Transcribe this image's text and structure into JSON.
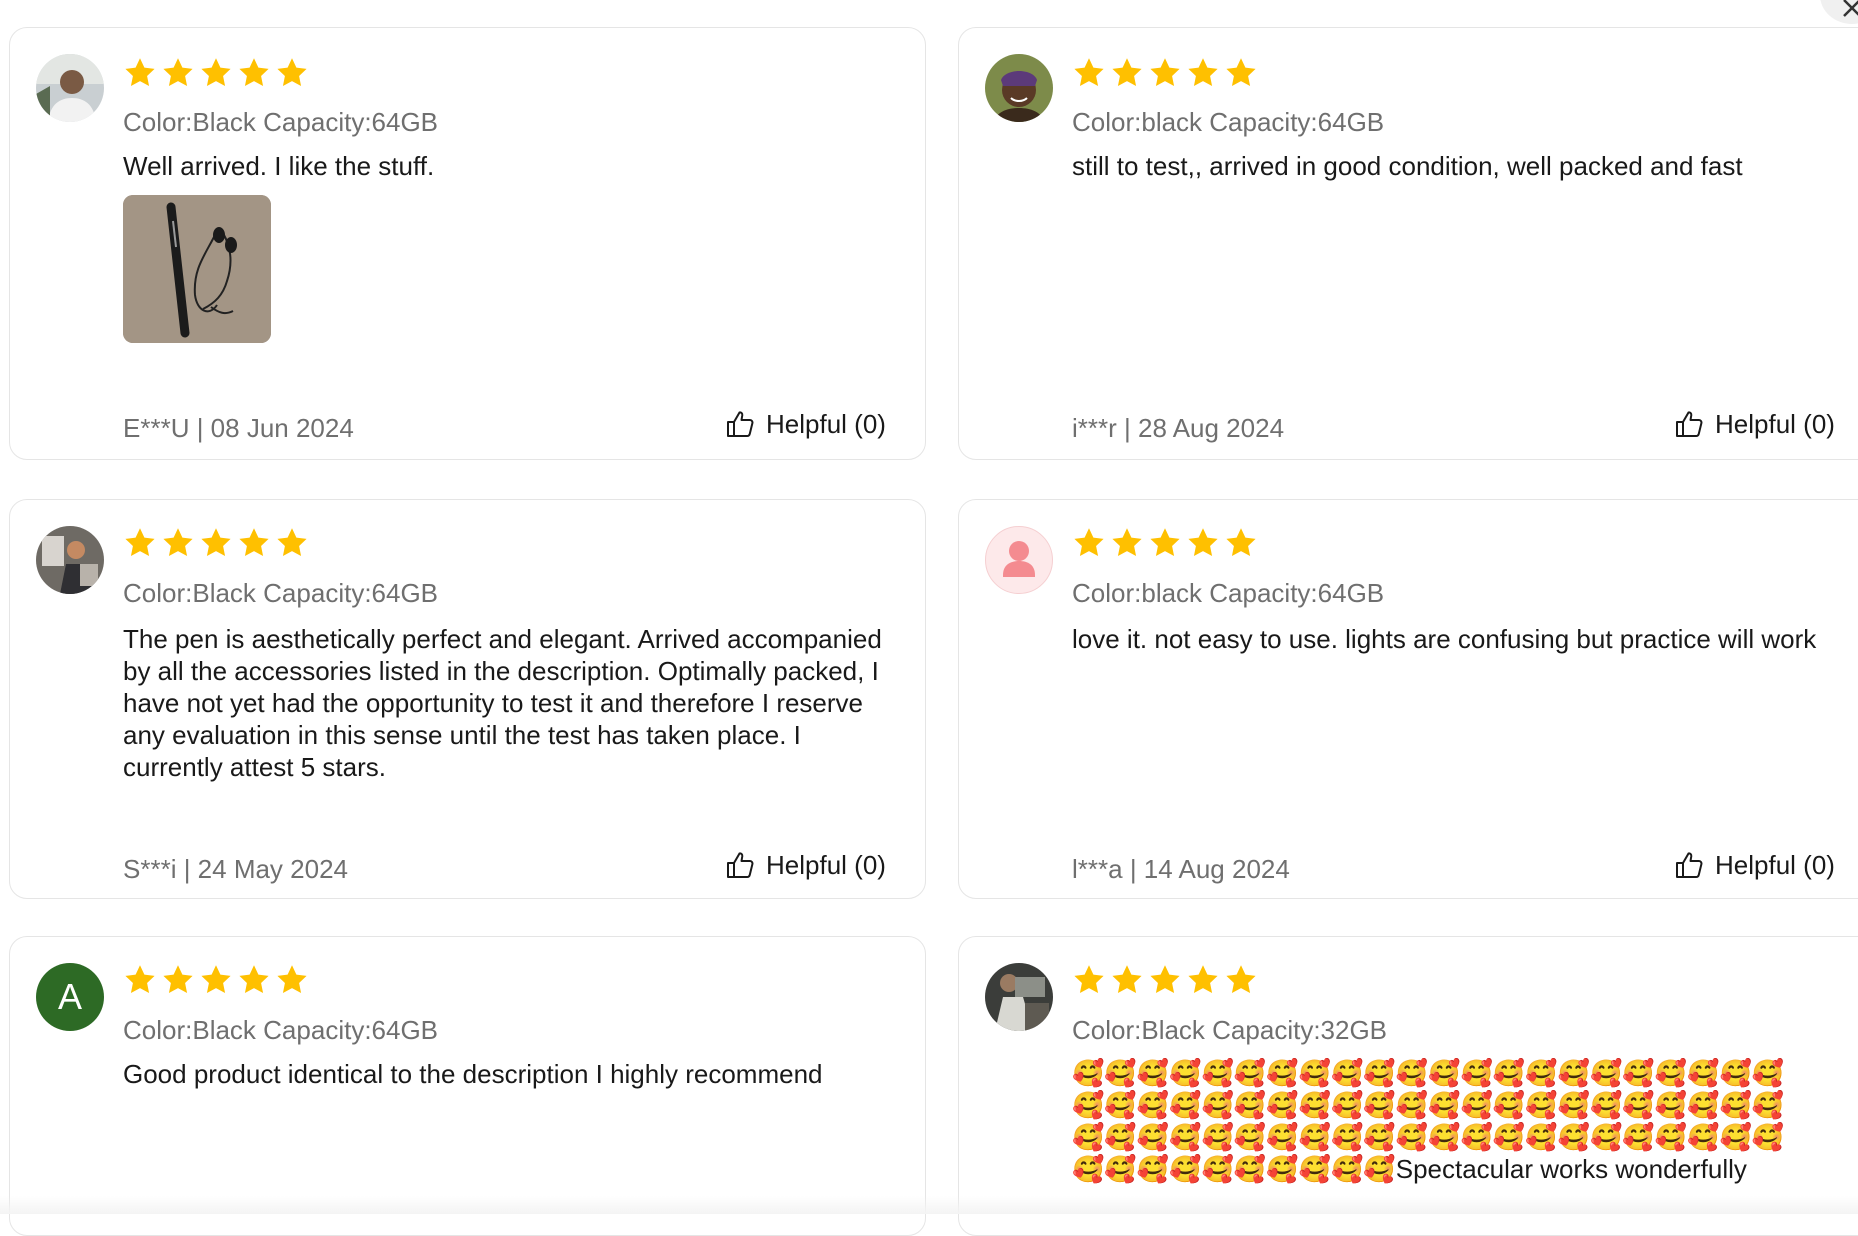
{
  "colors": {
    "star": "#FFC000",
    "text": "#191919",
    "muted": "#6f6f6f",
    "border": "#e5e5e5",
    "letter_avatar_bg": "#2d6a25"
  },
  "icons": {
    "star": "star-icon",
    "helpful": "thumbs-up-icon",
    "close": "close-icon",
    "default_avatar": "user-silhouette-icon"
  },
  "reviews": [
    {
      "rating": 5,
      "sku": "Color:Black Capacity:64GB",
      "text": "Well arrived. I like the stuff.",
      "has_photo": true,
      "author_date": "E***U | 08 Jun 2024",
      "helpful": "Helpful (0)"
    },
    {
      "rating": 5,
      "sku": "Color:black Capacity:64GB",
      "text": "still to test,, arrived in good condition, well packed and fast",
      "has_photo": false,
      "author_date": "i***r | 28 Aug 2024",
      "helpful": "Helpful (0)"
    },
    {
      "rating": 5,
      "sku": "Color:Black Capacity:64GB",
      "text": "The pen is aesthetically perfect and elegant. Arrived accompanied by all the accessories listed in the description. Optimally packed, I have not yet had the opportunity to test it and therefore I reserve any evaluation in this sense until the test has taken place. I currently attest 5 stars.",
      "has_photo": false,
      "author_date": "S***i | 24 May 2024",
      "helpful": "Helpful (0)"
    },
    {
      "rating": 5,
      "sku": "Color:black Capacity:64GB",
      "text": "love it. not easy to use. lights are confusing but practice will work",
      "has_photo": false,
      "author_date": "l***a | 14 Aug 2024",
      "helpful": "Helpful (0)"
    },
    {
      "rating": 5,
      "sku": "Color:Black Capacity:64GB",
      "text": "Good product identical to the description I highly recommend",
      "avatar_letter": "A",
      "has_photo": false
    },
    {
      "rating": 5,
      "sku": "Color:Black Capacity:32GB",
      "text": "🥰🥰🥰🥰🥰🥰🥰🥰🥰🥰🥰🥰🥰🥰🥰🥰🥰🥰🥰🥰🥰🥰🥰🥰🥰🥰🥰🥰🥰🥰🥰🥰🥰🥰🥰🥰🥰🥰🥰🥰🥰🥰🥰🥰🥰🥰🥰🥰🥰🥰🥰🥰🥰🥰🥰🥰🥰🥰🥰🥰🥰🥰🥰🥰🥰🥰🥰🥰🥰🥰🥰🥰🥰🥰🥰🥰Spectacular works wonderfully",
      "has_photo": false
    }
  ]
}
